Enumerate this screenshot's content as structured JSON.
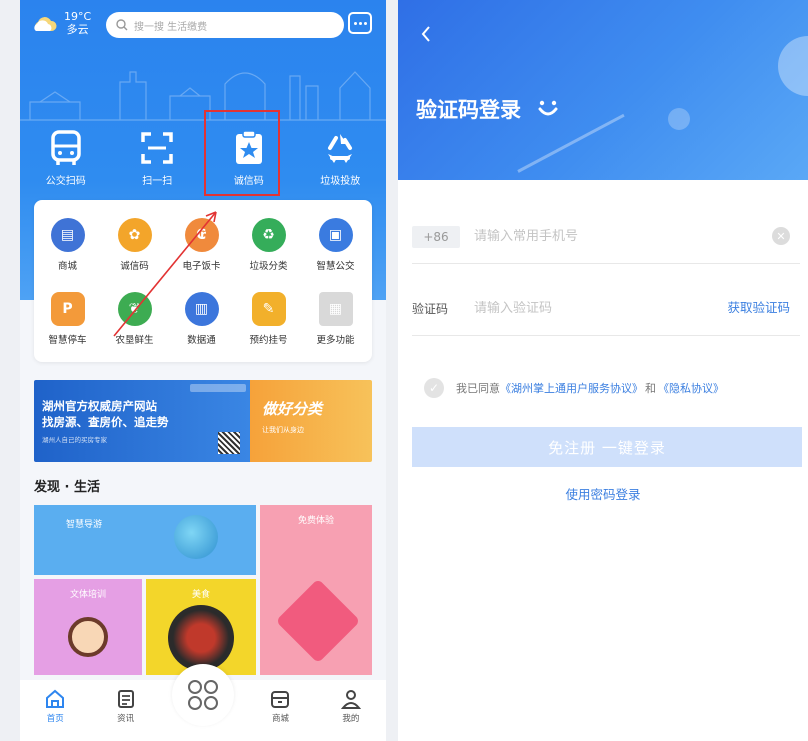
{
  "left": {
    "weather": {
      "temp": "19°C",
      "cond": "多云"
    },
    "search": {
      "placeholder": "搜一搜 生活缴费"
    },
    "quick": [
      {
        "label": "公交扫码",
        "icon": "bus-icon"
      },
      {
        "label": "扫一扫",
        "icon": "scan-icon"
      },
      {
        "label": "诚信码",
        "icon": "credit-code-icon"
      },
      {
        "label": "垃圾投放",
        "icon": "recycle-icon"
      }
    ],
    "grid": [
      {
        "label": "商城",
        "icon": "shop-icon",
        "color": "#3f73d6",
        "glyph": "▤"
      },
      {
        "label": "诚信码",
        "icon": "badge-icon",
        "color": "#f3a52a",
        "glyph": "✿"
      },
      {
        "label": "电子饭卡",
        "icon": "meal-card-icon",
        "color": "#f08a3c",
        "glyph": "₢"
      },
      {
        "label": "垃圾分类",
        "icon": "recycle-icon",
        "color": "#35ad5a",
        "glyph": "♻"
      },
      {
        "label": "智慧公交",
        "icon": "bus-icon",
        "color": "#3a7be0",
        "glyph": "▣"
      },
      {
        "label": "智慧停车",
        "icon": "parking-icon",
        "color": "#f39a3a",
        "glyph": "P"
      },
      {
        "label": "农垦鲜生",
        "icon": "leaf-icon",
        "color": "#3dac52",
        "glyph": "❦"
      },
      {
        "label": "数据通",
        "icon": "data-chart-icon",
        "color": "#3c76dc",
        "glyph": "▥"
      },
      {
        "label": "预约挂号",
        "icon": "appointment-icon",
        "color": "#f2b02b",
        "glyph": "✎"
      },
      {
        "label": "更多功能",
        "icon": "more-grid-icon",
        "color": "#d9d9d9",
        "glyph": "▦"
      }
    ],
    "banner": {
      "line1": "湖州官方权威房产网站",
      "line2": "找房源、查房价、追走势",
      "small": "湖州人自己的买房专家",
      "right_title": "做好分类",
      "right_sub": "让我们从身边"
    },
    "discover_title": "发现 · 生活",
    "tiles": {
      "t1": "智慧导游",
      "t2": "免费体验",
      "t3": "文体培训",
      "t4": "美食"
    },
    "tabs": [
      {
        "label": "首页",
        "icon": "home-icon",
        "active": true
      },
      {
        "label": "资讯",
        "icon": "news-icon",
        "active": false
      },
      {
        "label": "商城",
        "icon": "store-icon",
        "active": false
      },
      {
        "label": "我的",
        "icon": "profile-icon",
        "active": false
      }
    ]
  },
  "right": {
    "title": "验证码登录",
    "country_code": "+86",
    "phone_placeholder": "请输入常用手机号",
    "code_label": "验证码",
    "code_placeholder": "请输入验证码",
    "get_code": "获取验证码",
    "agree_prefix": "我已同意",
    "agree_link1": "《湖州掌上通用户服务协议》",
    "agree_and": "和",
    "agree_link2": "《隐私协议》",
    "login_button": "免注册 一键登录",
    "password_login": "使用密码登录"
  },
  "colors": {
    "primary": "#2e86ef",
    "link": "#3b7fe0",
    "highlight": "#e23333"
  }
}
